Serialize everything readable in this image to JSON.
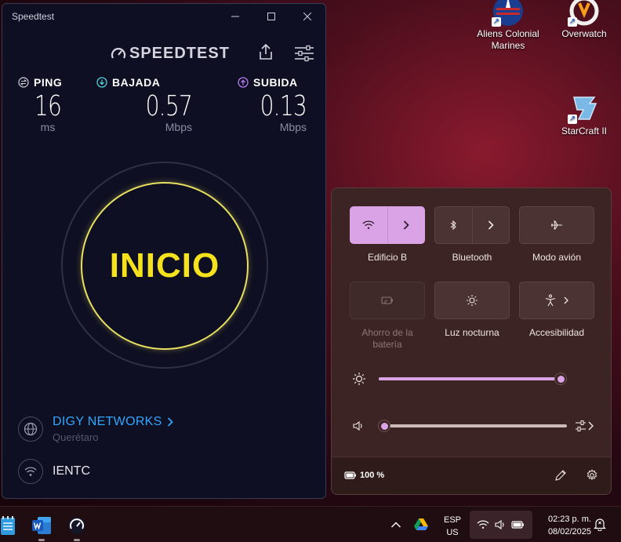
{
  "desktop": {
    "icons": [
      {
        "label": "Aliens Colonial Marines"
      },
      {
        "label": "Overwatch"
      },
      {
        "label": "StarCraft II"
      }
    ]
  },
  "speedtest": {
    "window_title": "Speedtest",
    "logo": "SPEEDTEST",
    "ping": {
      "label": "PING",
      "value": "16",
      "unit": "ms"
    },
    "download": {
      "label": "BAJADA",
      "value": "0.57",
      "unit": "Mbps"
    },
    "upload": {
      "label": "SUBIDA",
      "value": "0.13",
      "unit": "Mbps"
    },
    "go_label": "INICIO",
    "provider": {
      "name": "DIGY NETWORKS",
      "location": "Querétaro"
    },
    "network": "IENTC"
  },
  "quick_settings": {
    "tiles": [
      {
        "label": "Edificio B",
        "active": true
      },
      {
        "label": "Bluetooth",
        "active": false
      },
      {
        "label": "Modo avión",
        "active": false
      },
      {
        "label": "Ahorro de la batería",
        "active": false,
        "disabled": true
      },
      {
        "label": "Luz nocturna",
        "active": false
      },
      {
        "label": "Accesibilidad",
        "active": false
      }
    ],
    "brightness": 0.99,
    "volume": 0.03,
    "battery_text": "100 %"
  },
  "taskbar": {
    "lang_line1": "ESP",
    "lang_line2": "US",
    "time": "02:23 p. m.",
    "date": "08/02/2025"
  },
  "colors": {
    "accent": "#d9a3e6",
    "go_yellow": "#f5e21d",
    "provider_blue": "#31a7ff"
  }
}
